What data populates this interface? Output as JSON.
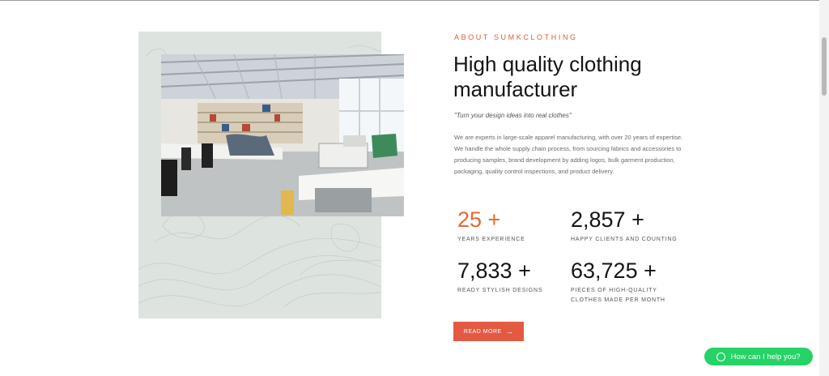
{
  "about": {
    "eyebrow": "ABOUT SUMKCLOTHING",
    "heading": "High quality clothing manufacturer",
    "quote": "\"Turn your design ideas into real clothes\"",
    "paragraph": "We are experts in large-scale apparel manufacturing, with over 20 years of expertise. We handle the whole supply chain process, from sourcing fabrics and accessories to producing samples, brand development by adding logos, bulk garment production, packaging, quality control inspections, and product delivery."
  },
  "stats": [
    {
      "value": "25 +",
      "label": "YEARS EXPERIENCE"
    },
    {
      "value": "2,857 +",
      "label": "HAPPY CLIENTS AND COUNTING"
    },
    {
      "value": "7,833 +",
      "label": "READY STYLISH DESIGNS"
    },
    {
      "value": "63,725 +",
      "label": "PIECES OF HIGH-QUALITY CLOTHES MADE PER MONTH"
    }
  ],
  "cta": {
    "read_more": "READ MORE",
    "arrow_icon": "arrow-right-icon"
  },
  "chat": {
    "label": "How can I help you?",
    "icon": "whatsapp-icon"
  },
  "colors": {
    "accent": "#e25a34",
    "button": "#e25a42",
    "chat": "#25d366",
    "panel": "#dde3df"
  }
}
